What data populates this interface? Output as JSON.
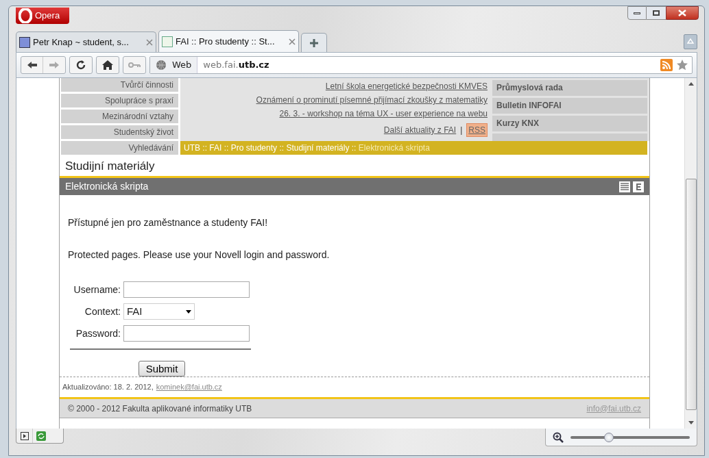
{
  "window": {
    "app_button": "Opera"
  },
  "tabs": [
    {
      "title": "Petr Knap ~ student, s...",
      "selected": false
    },
    {
      "title": "FAI :: Pro studenty :: St...",
      "selected": true
    }
  ],
  "address_bar": {
    "label": "Web",
    "url": "web.fai.**utb.cz**"
  },
  "page": {
    "nav": [
      "Tvůrčí činnosti",
      "Spolupráce s praxí",
      "Mezinárodní vztahy",
      "Studentský život",
      "Vyhledávání"
    ],
    "news": [
      "Letní škola energetické bezpečnosti KMVES",
      "Oznámení o prominutí písemné přijímací zkoušky z matematiky",
      "26. 3. - workshop na téma UX - user experience na webu"
    ],
    "more_news": "Další aktuality z FAI",
    "separator": "|",
    "rss": "RSS",
    "side_links": [
      "Průmyslová rada",
      "Bulletin INFOFAI",
      "Kurzy KNX"
    ],
    "breadcrumb": {
      "path": "UTB :: FAI :: Pro studenty :: Studijní materiály ::",
      "current": "Elektronická skripta"
    },
    "heading": "Studijní materiály",
    "section_title": "Elektronická skripta",
    "notice": "Přístupné jen pro zaměstnance a studenty FAI!",
    "instruction": "Protected pages. Please use your Novell login and password.",
    "form": {
      "fields": [
        {
          "label": "Username:",
          "kind": "text"
        },
        {
          "label": "Context:",
          "kind": "select",
          "value": "FAI"
        },
        {
          "label": "Password:",
          "kind": "text"
        }
      ],
      "submit": "Submit"
    },
    "updated": "Aktualizováno: 18. 2. 2012,",
    "updated_email": "kominek@fai.utb.cz",
    "copyright": "© 2000 - 2012 Fakulta aplikované informatiky UTB",
    "contact_email": "info@fai.utb.cz"
  },
  "status_bar": {
    "zoom": {
      "level": 0.32
    }
  }
}
